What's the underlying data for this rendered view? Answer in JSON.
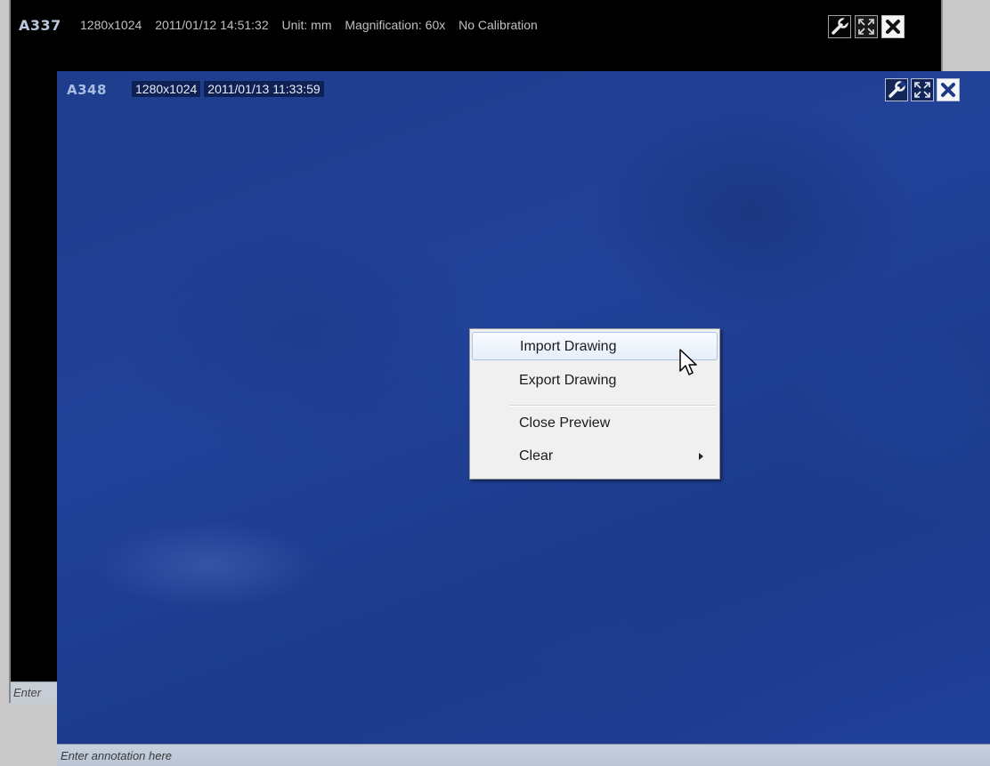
{
  "back_window": {
    "id": "A337",
    "resolution": "1280x1024",
    "datetime": "2011/01/12 14:51:32",
    "unit": "Unit: mm",
    "magnification": "Magnification: 60x",
    "calibration": "No Calibration",
    "annotation_placeholder": "Enter",
    "icons": [
      "wrench-icon",
      "expand-icon",
      "close-icon"
    ]
  },
  "front_window": {
    "id": "A348",
    "resolution": "1280x1024",
    "datetime": "2011/01/13 11:33:59",
    "annotation_placeholder": "Enter annotation here",
    "icons": [
      "wrench-icon",
      "expand-icon",
      "close-icon"
    ]
  },
  "context_menu": {
    "items": [
      {
        "label": "Import Drawing",
        "highlighted": true
      },
      {
        "label": "Export Drawing"
      },
      {
        "label": "Close Preview"
      },
      {
        "label": "Clear",
        "submenu": true
      }
    ]
  }
}
